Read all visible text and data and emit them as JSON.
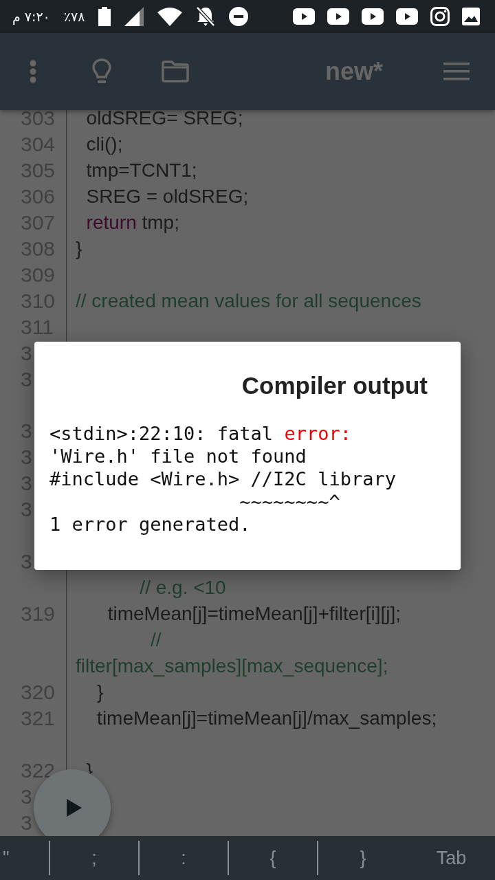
{
  "status_bar": {
    "time": "٧:٢٠ م",
    "battery": "٪٧٨"
  },
  "app_bar": {
    "title": "new*"
  },
  "editor": {
    "rows": [
      {
        "number": "303",
        "code": [
          {
            "kind": "plain",
            "text": "  oldSREG= SREG;"
          }
        ]
      },
      {
        "number": "304",
        "code": [
          {
            "kind": "plain",
            "text": "  cli();"
          }
        ]
      },
      {
        "number": "305",
        "code": [
          {
            "kind": "plain",
            "text": "  tmp=TCNT1;"
          }
        ]
      },
      {
        "number": "306",
        "code": [
          {
            "kind": "plain",
            "text": "  SREG = oldSREG;"
          }
        ]
      },
      {
        "number": "307",
        "code": [
          {
            "kind": "keyword",
            "text": "  return"
          },
          {
            "kind": "plain",
            "text": " tmp;"
          }
        ]
      },
      {
        "number": "308",
        "code": [
          {
            "kind": "plain",
            "text": "}"
          }
        ]
      },
      {
        "number": "309",
        "code": []
      },
      {
        "number": "310",
        "code": [
          {
            "kind": "comment",
            "text": "// created mean values for all sequences"
          }
        ]
      },
      {
        "number": "311",
        "code": []
      },
      {
        "number": "3",
        "code": []
      },
      {
        "number": "3",
        "code": []
      },
      {
        "code": []
      },
      {
        "number": "3",
        "code": []
      },
      {
        "number": "3",
        "code": []
      },
      {
        "number": "3",
        "code": []
      },
      {
        "number": "3",
        "code": []
      },
      {
        "code": []
      },
      {
        "number": "3",
        "code": []
      },
      {
        "code": [
          {
            "kind": "comment",
            "text": "            // e.g. <10"
          }
        ]
      },
      {
        "number": "319",
        "code": [
          {
            "kind": "plain",
            "text": "      timeMean[j]=timeMean[j]+filter[i][j];"
          }
        ]
      },
      {
        "code": [
          {
            "kind": "comment",
            "text": "              //"
          }
        ]
      },
      {
        "code": [
          {
            "kind": "comment",
            "text": "filter[max_samples][max_sequence];"
          }
        ]
      },
      {
        "number": "320",
        "code": [
          {
            "kind": "plain",
            "text": "    }"
          }
        ]
      },
      {
        "number": "321",
        "code": [
          {
            "kind": "plain",
            "text": "    timeMean[j]=timeMean[j]/max_samples;"
          }
        ]
      },
      {
        "code": []
      },
      {
        "number": "322",
        "code": [
          {
            "kind": "plain",
            "text": "  }"
          }
        ]
      },
      {
        "number": "3",
        "code": []
      },
      {
        "number": "3",
        "code": []
      }
    ]
  },
  "dialog": {
    "title": "Compiler output",
    "lines": [
      [
        {
          "kind": "plain",
          "text": "<stdin>:22:10: fatal "
        },
        {
          "kind": "error",
          "text": "error:"
        }
      ],
      [
        {
          "kind": "plain",
          "text": "'Wire.h' file not found"
        }
      ],
      [
        {
          "kind": "plain",
          "text": "#include <Wire.h> //I2C library"
        }
      ],
      [
        {
          "kind": "plain",
          "text": "                 ~~~~~~~~^"
        }
      ],
      [
        {
          "kind": "plain",
          "text": "1 error generated."
        }
      ]
    ]
  },
  "keys": [
    "\"",
    ";",
    ":",
    "{",
    "}",
    "Tab"
  ]
}
